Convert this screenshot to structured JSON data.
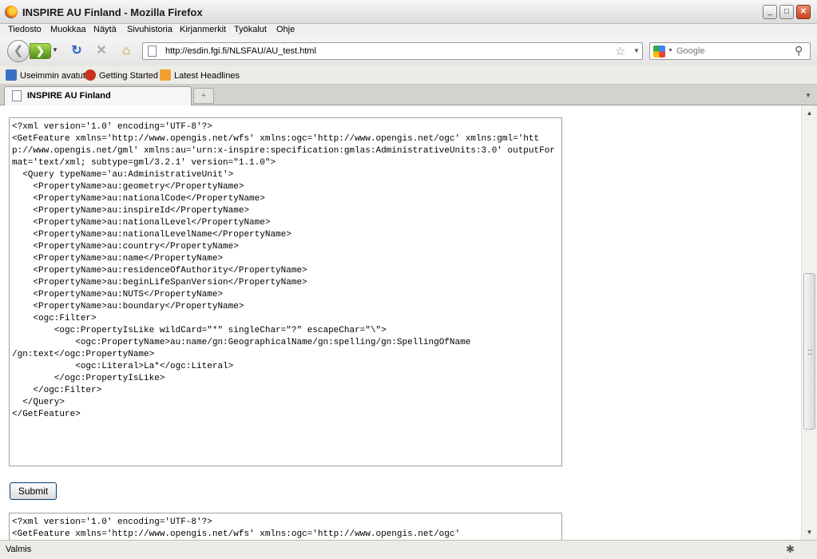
{
  "window": {
    "title": "INSPIRE AU Finland - Mozilla Firefox",
    "minimize": "_",
    "maximize": "□",
    "close": "✕"
  },
  "menu": [
    "Tiedosto",
    "Muokkaa",
    "Näytä",
    "Sivuhistoria",
    "Kirjanmerkit",
    "Työkalut",
    "Ohje"
  ],
  "nav": {
    "url": "http://esdin.fgi.fi/NLSFAU/AU_test.html",
    "search_placeholder": "Google"
  },
  "bookmarks": [
    "Useimmin avatut",
    "Getting Started",
    "Latest Headlines"
  ],
  "tabs": {
    "active": "INSPIRE AU Finland",
    "new_tab": "+"
  },
  "form": {
    "query_xml": "<?xml version='1.0' encoding='UTF-8'?>\n<GetFeature xmlns='http://www.opengis.net/wfs' xmlns:ogc='http://www.opengis.net/ogc' xmlns:gml='http://www.opengis.net/gml' xmlns:au='urn:x-inspire:specification:gmlas:AdministrativeUnits:3.0' outputFormat='text/xml; subtype=gml/3.2.1' version=\"1.1.0\">\n  <Query typeName='au:AdministrativeUnit'>\n    <PropertyName>au:geometry</PropertyName>\n    <PropertyName>au:nationalCode</PropertyName>\n    <PropertyName>au:inspireId</PropertyName>\n    <PropertyName>au:nationalLevel</PropertyName>\n    <PropertyName>au:nationalLevelName</PropertyName>\n    <PropertyName>au:country</PropertyName>\n    <PropertyName>au:name</PropertyName>\n    <PropertyName>au:residenceOfAuthority</PropertyName>\n    <PropertyName>au:beginLifeSpanVersion</PropertyName>\n    <PropertyName>au:NUTS</PropertyName>\n    <PropertyName>au:boundary</PropertyName>\n    <ogc:Filter>\n        <ogc:PropertyIsLike wildCard=\"*\" singleChar=\"?\" escapeChar=\"\\\">\n            <ogc:PropertyName>au:name/gn:GeographicalName/gn:spelling/gn:SpellingOfName\n/gn:text</ogc:PropertyName>\n            <ogc:Literal>La*</ogc:Literal>\n        </ogc:PropertyIsLike>\n    </ogc:Filter>\n  </Query>\n</GetFeature>",
    "submit_label": "Submit",
    "result_xml": "<?xml version='1.0' encoding='UTF-8'?>\n<GetFeature xmlns='http://www.opengis.net/wfs' xmlns:ogc='http://www.opengis.net/ogc'"
  },
  "status": {
    "text": "Valmis"
  }
}
